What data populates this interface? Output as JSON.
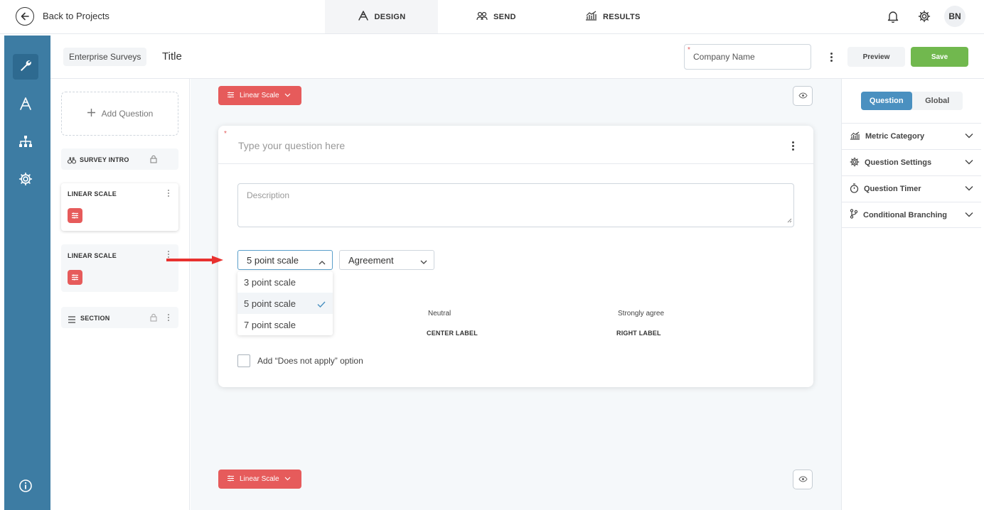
{
  "topbar": {
    "back_label": "Back to Projects",
    "tabs": [
      {
        "label": "DESIGN",
        "icon": "design-icon",
        "active": true
      },
      {
        "label": "SEND",
        "icon": "users-icon",
        "active": false
      },
      {
        "label": "RESULTS",
        "icon": "results-chart-icon",
        "active": false
      }
    ],
    "avatar_initials": "BN"
  },
  "header": {
    "breadcrumb": "Enterprise Surveys",
    "title": "Title",
    "company_placeholder": "Company Name",
    "preview_label": "Preview",
    "save_label": "Save",
    "save_color": "#71b84e"
  },
  "left_panel": {
    "add_question_label": "Add Question",
    "items": [
      {
        "label": "SURVEY INTRO",
        "locked": true
      },
      {
        "label": "LINEAR SCALE",
        "selected": true
      },
      {
        "label": "LINEAR SCALE",
        "selected": false
      },
      {
        "label": "SECTION",
        "locked": true
      }
    ]
  },
  "canvas": {
    "type_pill_label": "Linear Scale",
    "type_pill_color": "#e65b5b",
    "question_placeholder": "Type your question here",
    "description_placeholder": "Description",
    "scale_select": "5 point scale",
    "type_select": "Agreement",
    "scale_options": [
      "3 point scale",
      "5 point scale",
      "7 point scale"
    ],
    "selected_option": "5 point scale",
    "center_label": "CENTER LABEL",
    "right_label": "RIGHT LABEL",
    "center_value": "Neutral",
    "right_value": "Strongly agree",
    "na_option_label": "Add “Does not apply” option"
  },
  "right_panel": {
    "tabs": [
      "Question",
      "Global"
    ],
    "active_tab": "Question",
    "sections": [
      {
        "label": "Metric Category",
        "icon": "metric-chart-icon"
      },
      {
        "label": "Question Settings",
        "icon": "gear-icon"
      },
      {
        "label": "Question Timer",
        "icon": "timer-icon"
      },
      {
        "label": "Conditional Branching",
        "icon": "branch-icon"
      }
    ]
  },
  "colors": {
    "rail": "#3d7ca3",
    "accent_blue": "#4a90c0",
    "accent_red": "#e65b5b"
  }
}
